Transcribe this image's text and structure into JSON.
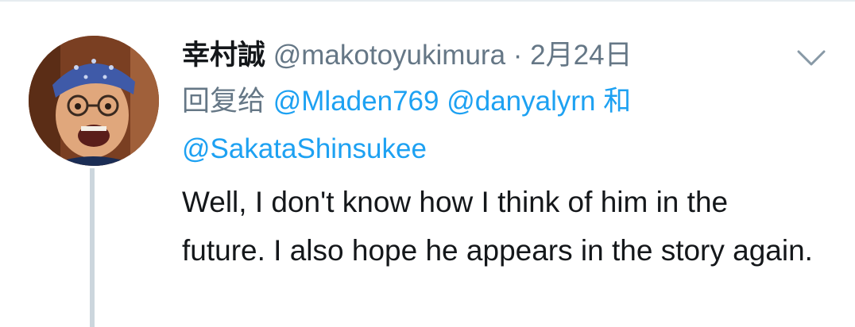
{
  "tweet": {
    "display_name": "幸村誠",
    "handle": "@makotoyukimura",
    "separator": "·",
    "date": "2月24日",
    "reply_prefix": "回复给",
    "reply_mentions": [
      "@Mladen769",
      "@danyalyrn",
      "@SakataShinsukee"
    ],
    "reply_conjunction": "和",
    "text": "Well, I don't know how I think of him in the future. I also hope he appears in the story again."
  },
  "colors": {
    "link": "#1da1f2",
    "secondary_text": "#657786",
    "primary_text": "#14171a",
    "thread_line": "#ccd6dd"
  },
  "icons": {
    "menu": "chevron-down-icon"
  }
}
